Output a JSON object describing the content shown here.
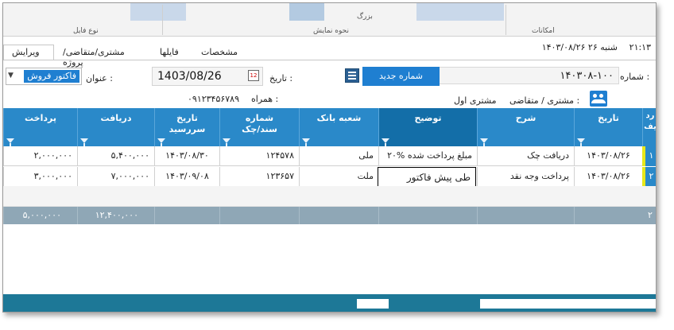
{
  "ribbon": {
    "label_file_type": "نوع فایل",
    "label_view_mode": "نحوه نمایش",
    "label_features": "امکانات",
    "label_large": "بزرگ"
  },
  "status": {
    "time": "۲۱:۱۳",
    "date": "شنبه ۲۶ ۱۴۰۳/۰۸/۲۶"
  },
  "tabs": [
    {
      "label": "ویرایش"
    },
    {
      "label": "مشتری/متقاضی/پروژه"
    },
    {
      "label": "فایلها"
    },
    {
      "label": "مشخصات"
    }
  ],
  "form": {
    "number_label": "شماره :",
    "number_value": "۱۴۰۳۰۸-۱۰۰",
    "new_number_button": "شماره جدید",
    "date_label": "تاریخ :",
    "date_value": "1403/08/26",
    "title_label": "عنوان :",
    "title_value": "فاکتور فروش",
    "customer_label": "مشتری / متقاضی :",
    "customer_value": "مشتری اول",
    "mobile_label": "همراه :",
    "mobile_value": "۰۹۱۲۳۴۵۶۷۸۹"
  },
  "grid": {
    "headers": {
      "row": "رد\nیف",
      "date": "تاریخ",
      "desc": "شرح",
      "note": "توضیح",
      "bank": "شعبه بانک",
      "doc": "شماره\nسند/چک",
      "due": "تاریخ\nسررسید",
      "recv": "دریافت",
      "pay": "پرداخت"
    },
    "rows": [
      {
        "num": "۱",
        "date": "۱۴۰۳/۰۸/۲۶",
        "desc": "دریافت چک",
        "note": "۲۰% مبلغ پرداخت شده",
        "bank": "ملی",
        "doc": "۱۲۴۵۷۸",
        "due": "۱۴۰۳/۰۸/۳۰",
        "recv": "۵,۴۰۰,۰۰۰",
        "pay": "۲,۰۰۰,۰۰۰"
      },
      {
        "num": "۲",
        "date": "۱۴۰۳/۰۸/۲۶",
        "desc": "پرداخت وجه نقد",
        "note": "طی پیش فاکتور",
        "bank": "ملت",
        "doc": "۱۲۳۶۵۷",
        "due": "۱۴۰۳/۰۹/۰۸",
        "recv": "۷,۰۰۰,۰۰۰",
        "pay": "۳,۰۰۰,۰۰۰"
      }
    ],
    "footer": {
      "count": "۲",
      "recv_total": "۱۲,۴۰۰,۰۰۰",
      "pay_total": "۵,۰۰۰,۰۰۰"
    }
  },
  "colors": {
    "header_blue": "#2a89c9",
    "accent_blue": "#1f7fd1",
    "footer_gray": "#8fa7b6",
    "row_marker": "#e8e81a"
  }
}
